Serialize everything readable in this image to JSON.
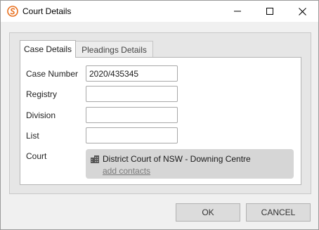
{
  "window": {
    "title": "Court Details",
    "icon": "app-logo-icon",
    "controls": [
      "minimize-icon",
      "maximize-icon",
      "close-icon"
    ]
  },
  "tabs": [
    {
      "label": "Case Details",
      "active": true
    },
    {
      "label": "Pleadings Details",
      "active": false
    }
  ],
  "fields": {
    "case_number": {
      "label": "Case Number",
      "value": "2020/435345"
    },
    "registry": {
      "label": "Registry",
      "value": ""
    },
    "division": {
      "label": "Division",
      "value": ""
    },
    "list": {
      "label": "List",
      "value": ""
    }
  },
  "court": {
    "label": "Court",
    "icon": "building-icon",
    "name": "District Court of NSW - Downing Centre",
    "link": "add contacts"
  },
  "buttons": {
    "ok": "OK",
    "cancel": "CANCEL"
  },
  "colors": {
    "accent": "#e8701f",
    "link": "#7a7a7a",
    "court_box": "#d6d6d6"
  }
}
